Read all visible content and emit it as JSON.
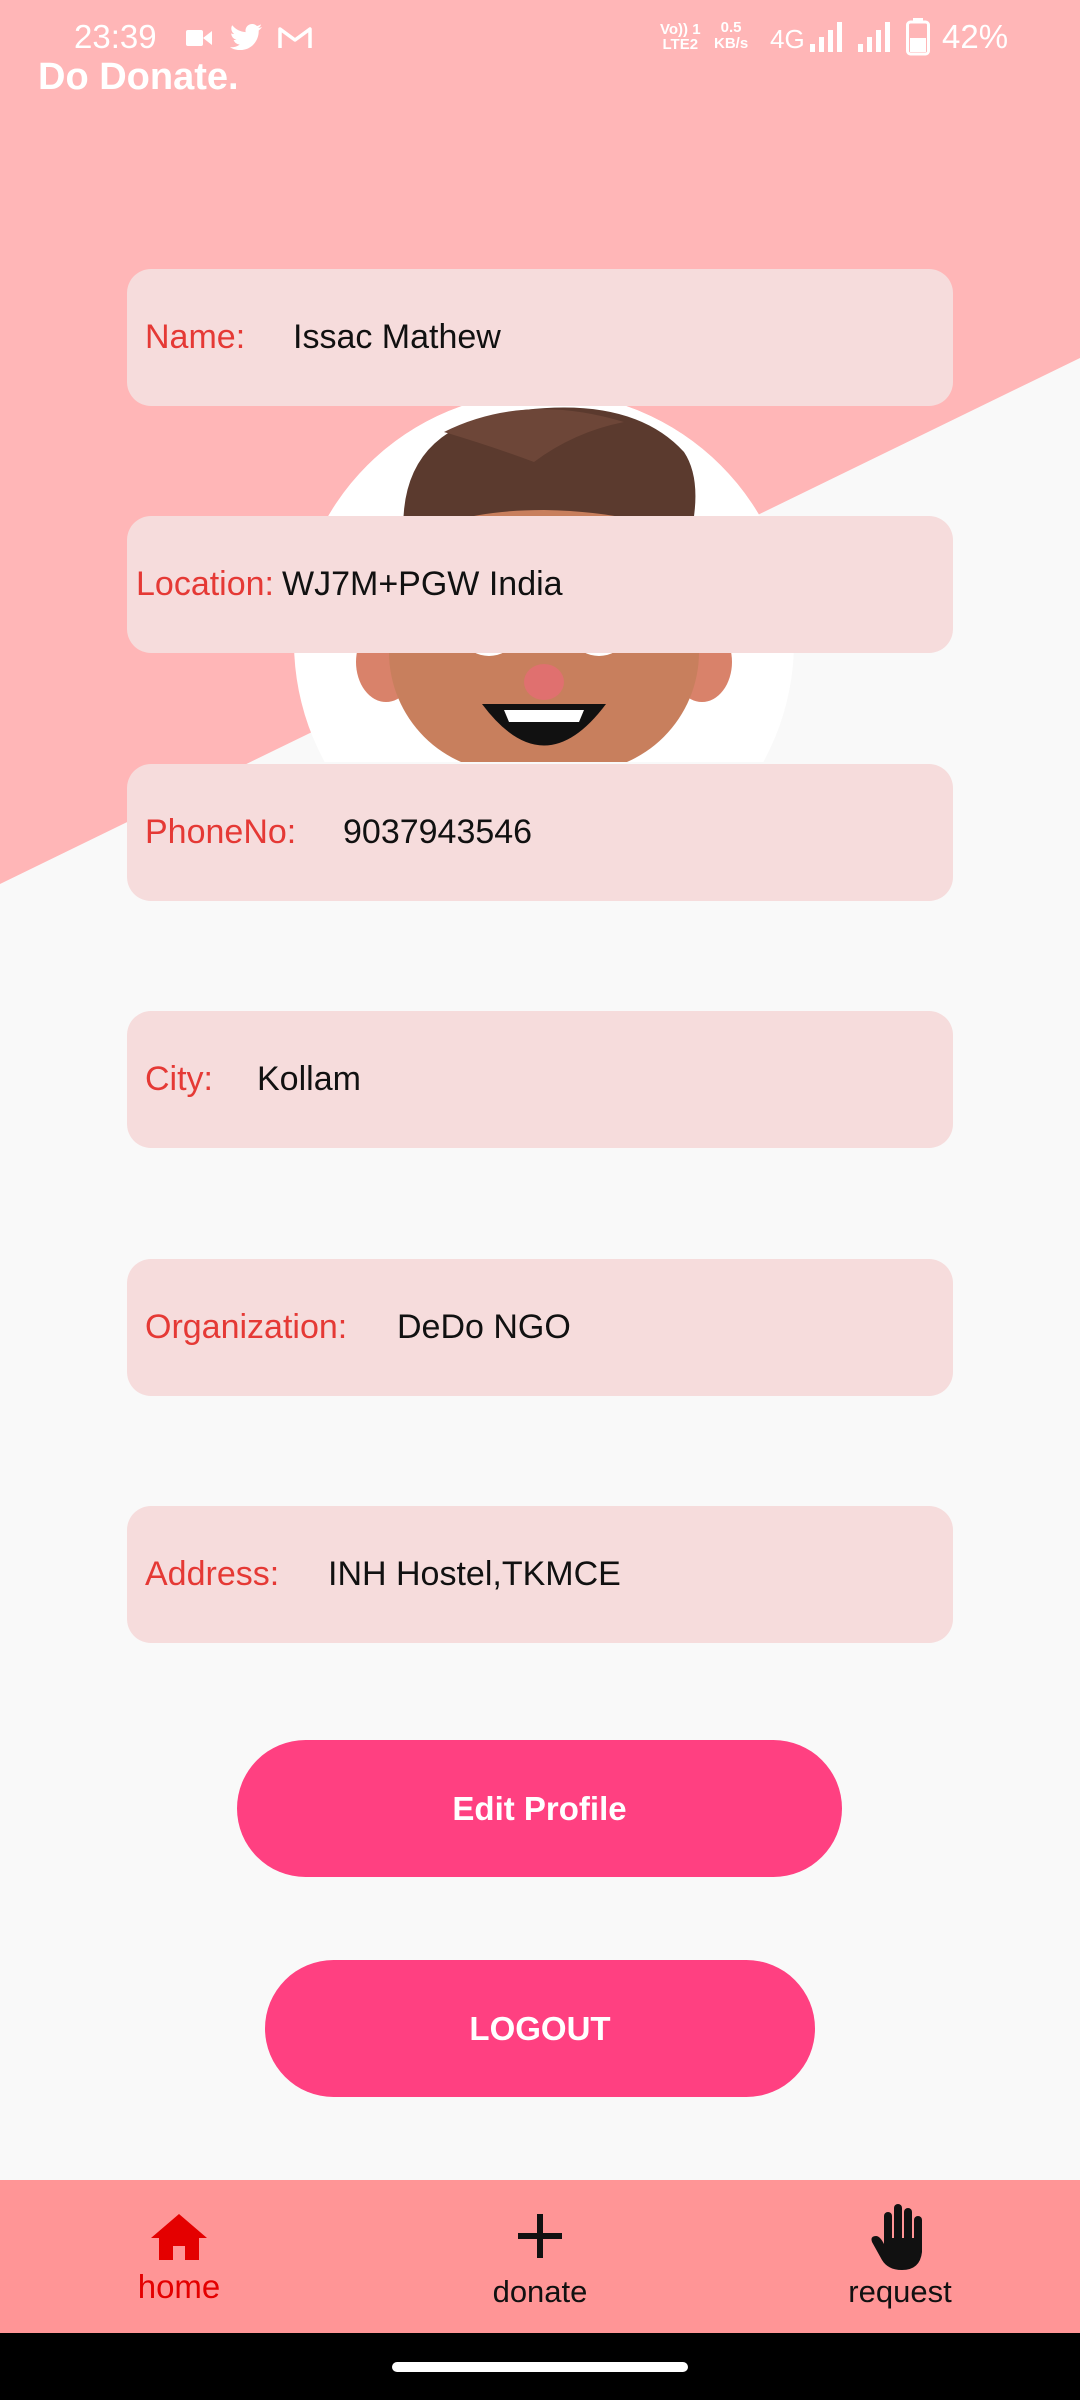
{
  "status_bar": {
    "time": "23:39",
    "volte_line1": "Vo)) 1",
    "volte_line2": "LTE2",
    "speed_line1": "0.5",
    "speed_line2": "KB/s",
    "network": "4G",
    "battery": "42%"
  },
  "app": {
    "title": "Do Donate."
  },
  "profile": {
    "fields": [
      {
        "label": "Name:",
        "value": "Issac Mathew"
      },
      {
        "label": "Location:",
        "value": "WJ7M+PGW India"
      },
      {
        "label": "PhoneNo:",
        "value": "9037943546"
      },
      {
        "label": "City:",
        "value": "Kollam"
      },
      {
        "label": "Organization:",
        "value": "DeDo NGO"
      },
      {
        "label": "Address:",
        "value": "INH Hostel,TKMCE"
      }
    ]
  },
  "buttons": {
    "edit_profile": "Edit Profile",
    "logout": "LOGOUT"
  },
  "nav": {
    "home": "home",
    "donate": "donate",
    "request": "request",
    "active_color": "#e40000"
  },
  "colors": {
    "header_pink": "#ffb6b7",
    "field_bg": "#f6dcdc",
    "label_red": "#e53935",
    "button_pink": "#ff4081",
    "nav_bg": "#ff9596"
  }
}
